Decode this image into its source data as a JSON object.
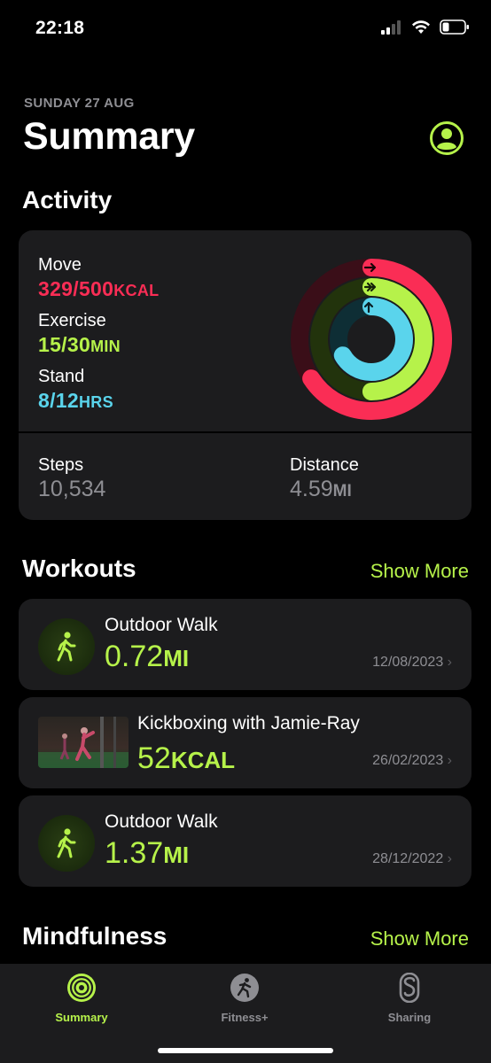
{
  "status_bar": {
    "time": "22:18"
  },
  "header": {
    "date": "SUNDAY 27 AUG",
    "title": "Summary"
  },
  "activity": {
    "section_title": "Activity",
    "move": {
      "label": "Move",
      "value": "329/500",
      "unit": "KCAL",
      "fraction": 0.658,
      "color": "#fa2d55"
    },
    "exercise": {
      "label": "Exercise",
      "value": "15/30",
      "unit": "MIN",
      "fraction": 0.5,
      "color": "#b6f24a"
    },
    "stand": {
      "label": "Stand",
      "value": "8/12",
      "unit": "HRS",
      "fraction": 0.667,
      "color": "#5ad4ec"
    },
    "steps": {
      "label": "Steps",
      "value": "10,534"
    },
    "distance": {
      "label": "Distance",
      "value": "4.59",
      "unit": "MI"
    }
  },
  "workouts": {
    "section_title": "Workouts",
    "show_more": "Show More",
    "items": [
      {
        "title": "Outdoor Walk",
        "value": "0.72",
        "unit": "MI",
        "date": "12/08/2023",
        "icon": "walking-icon"
      },
      {
        "title": "Kickboxing with Jamie-Ray",
        "value": "52",
        "unit": "KCAL",
        "date": "26/02/2023",
        "icon": "kickboxing-thumbnail"
      },
      {
        "title": "Outdoor Walk",
        "value": "1.37",
        "unit": "MI",
        "date": "28/12/2022",
        "icon": "walking-icon"
      }
    ]
  },
  "mindfulness": {
    "section_title": "Mindfulness",
    "show_more": "Show More"
  },
  "tab_bar": {
    "tabs": [
      {
        "label": "Summary",
        "icon": "activity-rings-icon",
        "active": true
      },
      {
        "label": "Fitness+",
        "icon": "running-icon",
        "active": false
      },
      {
        "label": "Sharing",
        "icon": "sharing-icon",
        "active": false
      }
    ]
  },
  "colors": {
    "accent": "#b6f24a",
    "move": "#fa2d55",
    "exercise": "#b6f24a",
    "stand": "#5ad4ec",
    "card": "#1c1c1e"
  }
}
